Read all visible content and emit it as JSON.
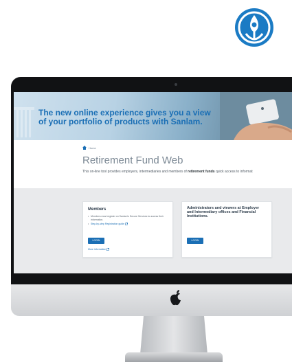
{
  "hero": {
    "headline_line1": "The new online experience gives you a view",
    "headline_line2": "of your portfolio of products with Sanlam."
  },
  "breadcrumb": {
    "home_label": "Home"
  },
  "page": {
    "title": "Retirement Fund Web",
    "intro_prefix": "This on-line tool provides employers, intermediaries and members of ",
    "intro_bold": "retirement funds",
    "intro_suffix": " quick access to informat"
  },
  "members_card": {
    "title": "Members",
    "bullet1": "Members must register on Sanlam's Secure Services to access their information.",
    "bullet2": "Step-by-step Registration guide",
    "login_label": "LOGIN",
    "more_info": "More information"
  },
  "admin_card": {
    "title": "Administrators and viewers at Employer and Intermediary offices and Financial Institutions.",
    "login_label": "LOGIN"
  },
  "colors": {
    "brand_blue": "#1b6fb5",
    "bezel": "#111214",
    "band_gray": "#e9eaec"
  },
  "icons": [
    "sanlam-logo-icon",
    "apple-logo-icon",
    "home-icon",
    "external-link-icon"
  ]
}
